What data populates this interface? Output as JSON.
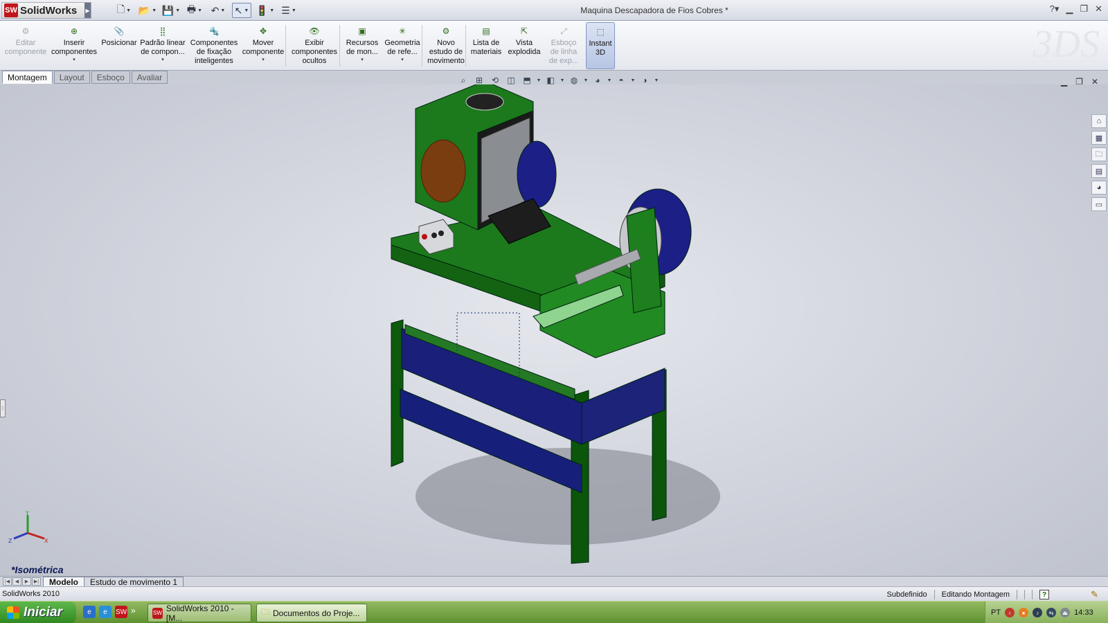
{
  "app": {
    "name": "SolidWorks",
    "logo": "SW"
  },
  "document_title": "Maquina Descapadora de Fios Cobres *",
  "quickbar": [
    {
      "icon": "new-document-icon",
      "glyph": "🗋"
    },
    {
      "icon": "open-folder-icon",
      "glyph": "📂"
    },
    {
      "icon": "save-icon",
      "glyph": "💾"
    },
    {
      "icon": "print-icon",
      "glyph": "🖶"
    },
    {
      "icon": "undo-icon",
      "glyph": "↶"
    },
    {
      "icon": "select-pointer-icon",
      "glyph": "↖"
    },
    {
      "icon": "rebuild-traffic-light-icon",
      "glyph": "🚦"
    },
    {
      "icon": "options-icon",
      "glyph": "☰"
    }
  ],
  "ribbon": {
    "buttons": [
      {
        "label1": "Editar",
        "label2": "componente",
        "label3": "",
        "icon": "edit-component-icon",
        "glyph": "⚙",
        "disabled": true,
        "dropdown": false
      },
      {
        "label1": "Inserir",
        "label2": "componentes",
        "label3": "",
        "icon": "insert-components-icon",
        "glyph": "⊕",
        "disabled": false,
        "dropdown": true
      },
      {
        "label1": "Posicionar",
        "label2": "",
        "label3": "",
        "icon": "mate-paperclip-icon",
        "glyph": "📎",
        "disabled": false,
        "dropdown": false
      },
      {
        "label1": "Padrão linear",
        "label2": "de compon...",
        "label3": "",
        "icon": "linear-pattern-icon",
        "glyph": "⣿",
        "disabled": false,
        "dropdown": true
      },
      {
        "label1": "Componentes",
        "label2": "de fixação",
        "label3": "inteligentes",
        "icon": "smart-fasteners-icon",
        "glyph": "🔩",
        "disabled": false,
        "dropdown": false
      },
      {
        "label1": "Mover",
        "label2": "componente",
        "label3": "",
        "icon": "move-component-icon",
        "glyph": "✥",
        "disabled": false,
        "dropdown": true
      },
      {
        "label1": "Exibir",
        "label2": "componentes",
        "label3": "ocultos",
        "icon": "show-hidden-icon",
        "glyph": "👁",
        "disabled": false,
        "dropdown": false
      },
      {
        "label1": "Recursos",
        "label2": "de mon...",
        "label3": "",
        "icon": "assembly-features-icon",
        "glyph": "▣",
        "disabled": false,
        "dropdown": true
      },
      {
        "label1": "Geometria",
        "label2": "de refe...",
        "label3": "",
        "icon": "reference-geometry-icon",
        "glyph": "✳",
        "disabled": false,
        "dropdown": true
      },
      {
        "label1": "Novo",
        "label2": "estudo de",
        "label3": "movimento",
        "icon": "motion-study-icon",
        "glyph": "⚙",
        "disabled": false,
        "dropdown": false
      },
      {
        "label1": "Lista de",
        "label2": "materiais",
        "label3": "",
        "icon": "bill-of-materials-icon",
        "glyph": "▤",
        "disabled": false,
        "dropdown": false
      },
      {
        "label1": "Vista",
        "label2": "explodida",
        "label3": "",
        "icon": "exploded-view-icon",
        "glyph": "⇱",
        "disabled": false,
        "dropdown": false
      },
      {
        "label1": "Esboço",
        "label2": "de linha",
        "label3": "de exp...",
        "icon": "explode-line-sketch-icon",
        "glyph": "⤢",
        "disabled": true,
        "dropdown": false
      },
      {
        "label1": "Instant",
        "label2": "3D",
        "label3": "",
        "icon": "instant-3d-icon",
        "glyph": "⬚",
        "disabled": false,
        "dropdown": false,
        "active": true
      }
    ]
  },
  "command_tabs": [
    "Montagem",
    "Layout",
    "Esboço",
    "Avaliar"
  ],
  "viewport": {
    "orientation_label": "*Isométrica",
    "heads_up": [
      "zoom-to-fit-icon",
      "zoom-area-icon",
      "previous-view-icon",
      "section-view-icon",
      "view-orientation-icon",
      "display-style-icon",
      "hide-show-icon",
      "edit-appearance-icon",
      "apply-scene-icon",
      "view-settings-icon"
    ],
    "task_pane": [
      "solidworks-resources-icon",
      "design-library-icon",
      "file-explorer-icon",
      "view-palette-icon",
      "appearances-icon",
      "custom-properties-icon"
    ]
  },
  "bottom_tabs": [
    "Modelo",
    "Estudo de movimento 1"
  ],
  "status": {
    "left": "SolidWorks 2010",
    "state": "Subdefinido",
    "mode": "Editando Montagem"
  },
  "taskbar": {
    "start": "Iniciar",
    "tasks": [
      "SolidWorks 2010 - [M...",
      "Documentos do Proje..."
    ],
    "lang": "PT",
    "clock": "14:33"
  }
}
